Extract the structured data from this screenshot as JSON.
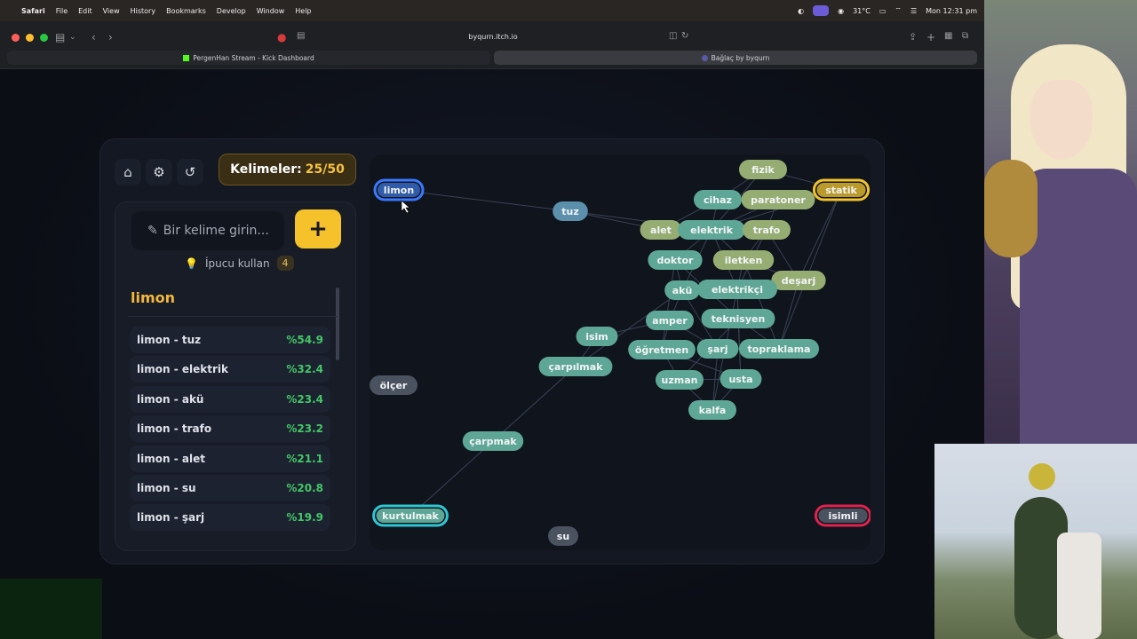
{
  "menubar": {
    "app": "Safari",
    "items": [
      "File",
      "Edit",
      "View",
      "History",
      "Bookmarks",
      "Develop",
      "Window",
      "Help"
    ],
    "temperature": "31°C",
    "clock": "Mon 12:31 pm"
  },
  "browser": {
    "url": "byqurn.itch.io",
    "tabs": [
      {
        "label": "PergenHan Stream - Kick Dashboard"
      },
      {
        "label": "Bağlaç by byqurn"
      }
    ]
  },
  "game": {
    "counter_label": "Kelimeler:",
    "counter_value": "25/50",
    "input_placeholder": "Bir kelime girin...",
    "add_label": "+",
    "hint_label": "İpucu kullan",
    "hint_count": "4",
    "current_word": "limon",
    "connections": [
      {
        "pair": "limon - tuz",
        "pct": "%54.9"
      },
      {
        "pair": "limon - elektrik",
        "pct": "%32.4"
      },
      {
        "pair": "limon - akü",
        "pct": "%23.4"
      },
      {
        "pair": "limon - trafo",
        "pct": "%23.2"
      },
      {
        "pair": "limon - alet",
        "pct": "%21.1"
      },
      {
        "pair": "limon - su",
        "pct": "%20.8"
      },
      {
        "pair": "limon - şarj",
        "pct": "%19.9"
      }
    ]
  },
  "graph": {
    "colors": {
      "blue": "#4a79d8",
      "green": "#8aa86c",
      "teal": "#5d9f8c",
      "cyan": "#33b8c2",
      "grey": "#4a5260",
      "steel": "#4f86a0"
    },
    "nodes": [
      {
        "id": "limon",
        "label": "limon",
        "color": "blue",
        "ring": "#3a78ff"
      },
      {
        "id": "tuz",
        "label": "tuz",
        "color": "steel"
      },
      {
        "id": "fizik",
        "label": "fizik",
        "color": "green"
      },
      {
        "id": "statik",
        "label": "statik",
        "color": "gold",
        "ring": "#f2c230"
      },
      {
        "id": "cihaz",
        "label": "cihaz",
        "color": "teal"
      },
      {
        "id": "paratoner",
        "label": "paratoner",
        "color": "green"
      },
      {
        "id": "alet",
        "label": "alet",
        "color": "green"
      },
      {
        "id": "elektrik",
        "label": "elektrik",
        "color": "teal"
      },
      {
        "id": "trafo",
        "label": "trafo",
        "color": "green"
      },
      {
        "id": "doktor",
        "label": "doktor",
        "color": "teal"
      },
      {
        "id": "iletken",
        "label": "iletken",
        "color": "green"
      },
      {
        "id": "desarj",
        "label": "deşarj",
        "color": "green"
      },
      {
        "id": "aku",
        "label": "akü",
        "color": "teal"
      },
      {
        "id": "elektrikci",
        "label": "elektrikçi",
        "color": "teal"
      },
      {
        "id": "amper",
        "label": "amper",
        "color": "teal"
      },
      {
        "id": "teknisyen",
        "label": "teknisyen",
        "color": "teal"
      },
      {
        "id": "isim",
        "label": "isim",
        "color": "teal"
      },
      {
        "id": "ogretmen",
        "label": "öğretmen",
        "color": "teal"
      },
      {
        "id": "sarj",
        "label": "şarj",
        "color": "teal"
      },
      {
        "id": "topraklama",
        "label": "topraklama",
        "color": "teal"
      },
      {
        "id": "carpilmak",
        "label": "çarpılmak",
        "color": "teal"
      },
      {
        "id": "uzman",
        "label": "uzman",
        "color": "teal"
      },
      {
        "id": "usta",
        "label": "usta",
        "color": "teal"
      },
      {
        "id": "kalfa",
        "label": "kalfa",
        "color": "teal"
      },
      {
        "id": "olcer",
        "label": "ölçer",
        "color": "grey"
      },
      {
        "id": "carpmak",
        "label": "çarpmak",
        "color": "teal"
      },
      {
        "id": "kurtulmak",
        "label": "kurtulmak",
        "color": "teal",
        "ring": "#2fc6d2"
      },
      {
        "id": "su",
        "label": "su",
        "color": "grey"
      },
      {
        "id": "isimli",
        "label": "isimli",
        "color": "grey",
        "ring": "#e0224e"
      }
    ]
  }
}
